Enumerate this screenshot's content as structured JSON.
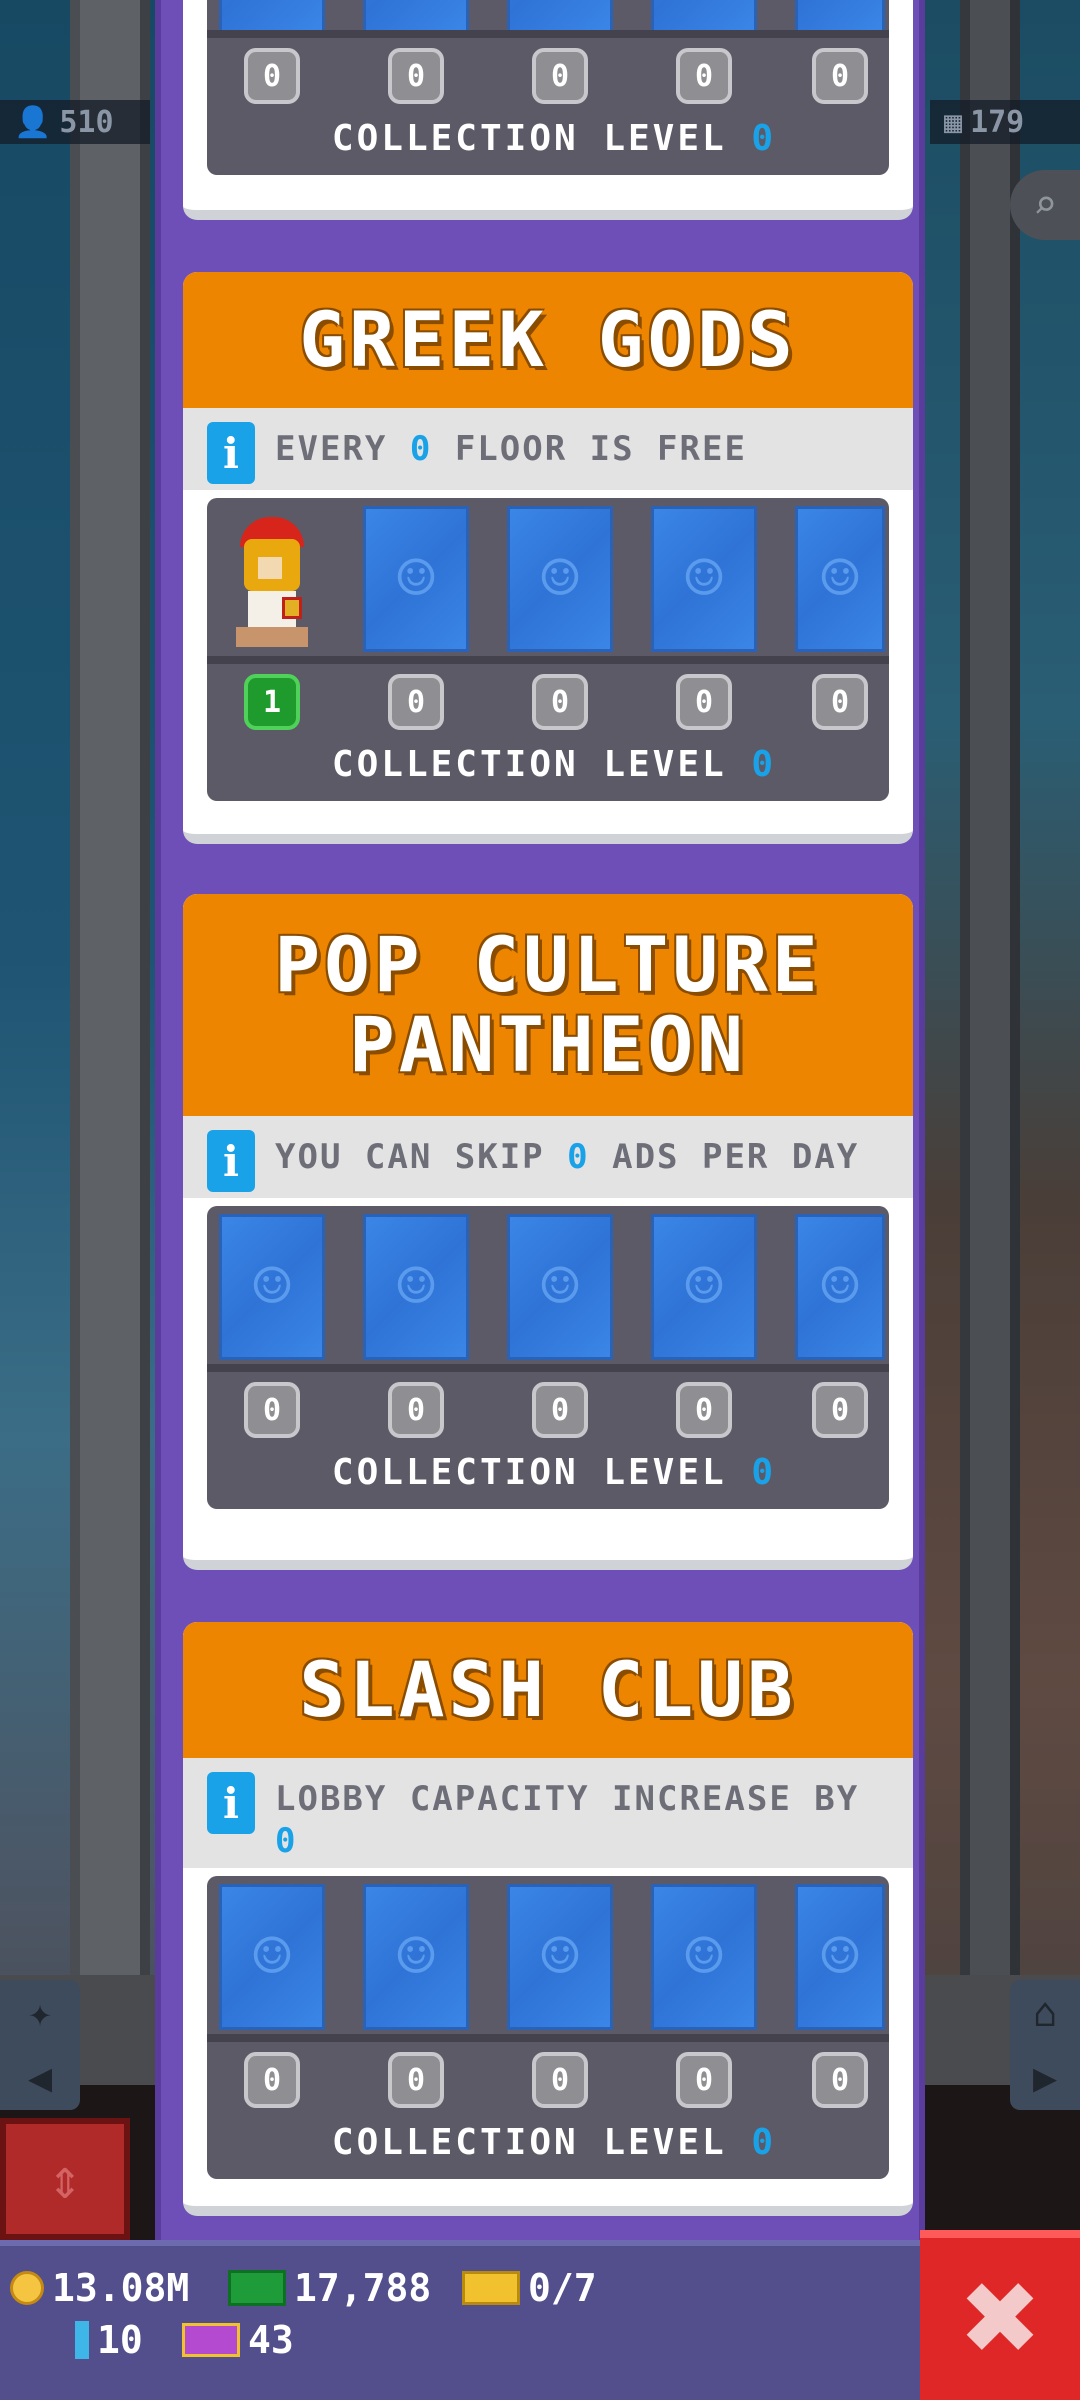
{
  "stats": {
    "population": "510",
    "floors": "179"
  },
  "collections": [
    {
      "id": "previous",
      "title": "",
      "badges": [
        "0",
        "0",
        "0",
        "0",
        "0"
      ],
      "collection_level_label": "COLLECTION LEVEL",
      "collection_level_value": "0"
    },
    {
      "id": "greek-gods",
      "title": "GREEK GODS",
      "perk_prefix": "EVERY",
      "perk_value": "0",
      "perk_suffix": "FLOOR IS FREE",
      "badges": [
        "1",
        "0",
        "0",
        "0",
        "0"
      ],
      "collection_level_label": "COLLECTION LEVEL",
      "collection_level_value": "0"
    },
    {
      "id": "pop-culture-pantheon",
      "title_line1": "POP CULTURE",
      "title_line2": "PANTHEON",
      "perk_prefix": "YOU CAN SKIP",
      "perk_value": "0",
      "perk_suffix": "ADS PER DAY",
      "badges": [
        "0",
        "0",
        "0",
        "0",
        "0"
      ],
      "collection_level_label": "COLLECTION LEVEL",
      "collection_level_value": "0"
    },
    {
      "id": "slash-club",
      "title": "SLASH CLUB",
      "perk_prefix": "LOBBY CAPACITY INCREASE BY",
      "perk_value": "0",
      "perk_suffix": "",
      "badges": [
        "0",
        "0",
        "0",
        "0",
        "0"
      ],
      "collection_level_label": "COLLECTION LEVEL",
      "collection_level_value": "0"
    }
  ],
  "resources": {
    "coins": "13.08M",
    "bux": "17,788",
    "tickets": "0/7",
    "keys": "10",
    "vip": "43"
  },
  "icons": {
    "info": "i",
    "close": "✖"
  },
  "colors": {
    "header_orange": "#ee8500",
    "panel_purple": "#6e4fb8",
    "accent_blue": "#1aa2e8",
    "close_red": "#e02727"
  }
}
